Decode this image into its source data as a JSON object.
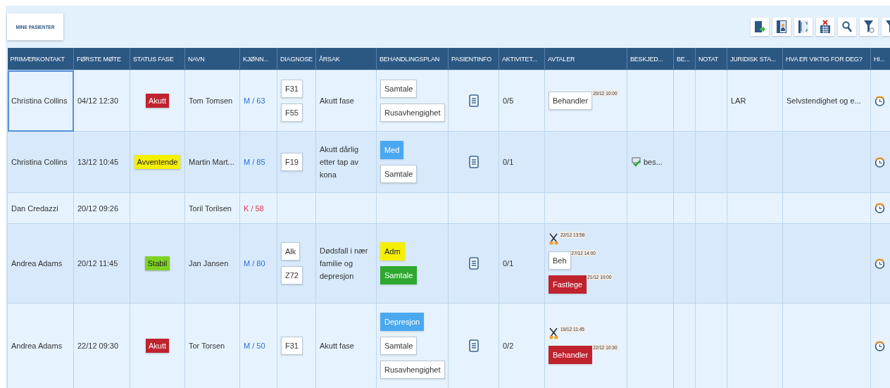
{
  "toolbar": {
    "button": "MINE PASIENTER"
  },
  "columns": [
    "PRIMÆRKONTAKT",
    "FØRSTE MØTE",
    "STATUS FASE",
    "NAVN",
    "KJØNN...",
    "DIAGNOSE",
    "ÅRSAK",
    "BEHANDLINGSPLAN",
    "PASIENTINFO",
    "AKTIVITET...",
    "AVTALER",
    "BESKJED...",
    "BE...",
    "NOTAT",
    "JURIDISK STA...",
    "HVA ER VIKTIG FOR DEG?",
    "HI..."
  ],
  "rows": [
    {
      "contact": "Christina Collins",
      "focused": true,
      "first_meeting": "04/12 12:30",
      "status": {
        "label": "Akutt",
        "color": "#c0222e"
      },
      "name": "Tom Tomsen",
      "gender_age": {
        "text": "M / 63",
        "kind": "male"
      },
      "diagnoses": [
        "F31",
        "F55"
      ],
      "cause": "Akutt fase",
      "plans": [
        {
          "label": "Samtale"
        },
        {
          "label": "Rusavhengighet"
        }
      ],
      "info_icon": true,
      "activity": "0/5",
      "appointments": [
        {
          "kind": "tag",
          "label": "Behandler",
          "time": "20/12 10:00"
        }
      ],
      "legal": "LAR",
      "important": "Selvstendighet og e..."
    },
    {
      "contact": "Christina Collins",
      "focused": false,
      "first_meeting": "13/12 10:45",
      "status": {
        "label": "Avventende",
        "color": "#f5f000"
      },
      "name": "Martin Mart...",
      "gender_age": {
        "text": "M / 85",
        "kind": "male"
      },
      "diagnoses": [
        "F19"
      ],
      "cause": "Akutt dårlig etter tap av kona",
      "plans": [
        {
          "label": "Med",
          "color": "#4aa8f0"
        },
        {
          "label": "Samtale"
        }
      ],
      "info_icon": true,
      "activity": "0/1",
      "message": "bes..."
    },
    {
      "contact": "Dan Credazzi",
      "focused": false,
      "first_meeting": "20/12 09:26",
      "name": "Toril Torilsen",
      "gender_age": {
        "text": "K / 58",
        "kind": "female"
      },
      "info_icon": false
    },
    {
      "contact": "Andrea Adams",
      "focused": false,
      "first_meeting": "20/12 11:45",
      "status": {
        "label": "Stabil",
        "color": "#7ed321"
      },
      "name": "Jan Jansen",
      "gender_age": {
        "text": "M / 80",
        "kind": "male"
      },
      "diagnoses": [
        "Alk",
        "Z72"
      ],
      "cause": "Dødsfall i nær familie og depresjon",
      "plans": [
        {
          "label": "Adm",
          "color": "#f5f000"
        },
        {
          "label": "Samtale",
          "color": "#2ea82e"
        }
      ],
      "info_icon": true,
      "activity": "0/1",
      "appointments": [
        {
          "kind": "scissors",
          "time": "22/12 13:58"
        },
        {
          "kind": "tag",
          "label": "Beh",
          "time": "27/12 14:00"
        },
        {
          "kind": "tag",
          "label": "Fastlege",
          "color": "#c0222e",
          "time": "21/12 10:00"
        }
      ]
    },
    {
      "contact": "Andrea Adams",
      "focused": false,
      "first_meeting": "22/12 09:30",
      "status": {
        "label": "Akutt",
        "color": "#c0222e"
      },
      "name": "Tor Torsen",
      "gender_age": {
        "text": "M / 50",
        "kind": "male"
      },
      "diagnoses": [
        "F31"
      ],
      "cause": "Akutt fase",
      "plans": [
        {
          "label": "Depresjon",
          "color": "#4aa8f0"
        },
        {
          "label": "Samtale"
        },
        {
          "label": "Rusavhengighet"
        }
      ],
      "info_icon": true,
      "activity": "0/2",
      "appointments": [
        {
          "kind": "scissors",
          "time": "19/12 11:45"
        },
        {
          "kind": "tag",
          "label": "Behandler",
          "color": "#c0222e",
          "time": "22/12 10:30"
        }
      ]
    }
  ]
}
